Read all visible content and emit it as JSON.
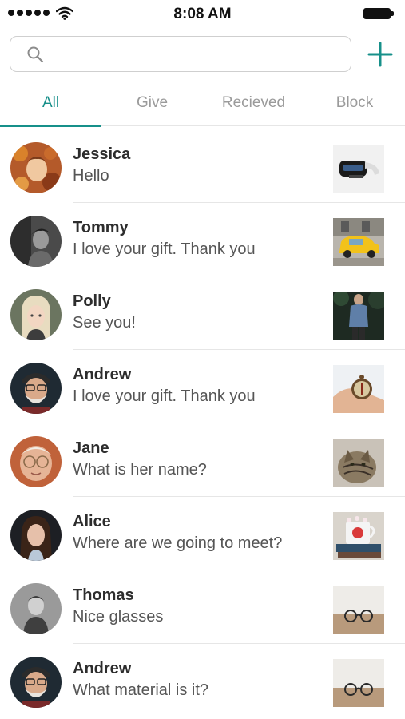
{
  "status_bar": {
    "time": "8:08 AM"
  },
  "search": {
    "value": "",
    "placeholder": ""
  },
  "tabs": [
    {
      "label": "All",
      "active": true
    },
    {
      "label": "Give",
      "active": false
    },
    {
      "label": "Recieved",
      "active": false
    },
    {
      "label": "Block",
      "active": false
    }
  ],
  "colors": {
    "accent": "#17908a",
    "divider": "#e6e6e6"
  },
  "conversations": [
    {
      "name": "Jessica",
      "message": "Hello",
      "avatar_icon": "woman-autumn-leaves",
      "thumbnail_icon": "vr-headset"
    },
    {
      "name": "Tommy",
      "message": "I love your gift. Thank you",
      "avatar_icon": "man-black-and-white",
      "thumbnail_icon": "yellow-car"
    },
    {
      "name": "Polly",
      "message": "See you!",
      "avatar_icon": "girl-blonde",
      "thumbnail_icon": "person-denim-jacket"
    },
    {
      "name": "Andrew",
      "message": "I love your gift. Thank you",
      "avatar_icon": "old-man-cap",
      "thumbnail_icon": "compass-in-hand"
    },
    {
      "name": "Jane",
      "message": "What is her name?",
      "avatar_icon": "old-woman-glasses",
      "thumbnail_icon": "tabby-cat"
    },
    {
      "name": "Alice",
      "message": "Where are we going to meet?",
      "avatar_icon": "woman-dark-hair",
      "thumbnail_icon": "mug-on-books"
    },
    {
      "name": "Thomas",
      "message": "Nice glasses",
      "avatar_icon": "man-monochrome",
      "thumbnail_icon": "glasses-on-table"
    },
    {
      "name": "Andrew",
      "message": "What material is it?",
      "avatar_icon": "old-man-cap",
      "thumbnail_icon": "glasses-on-table"
    }
  ]
}
